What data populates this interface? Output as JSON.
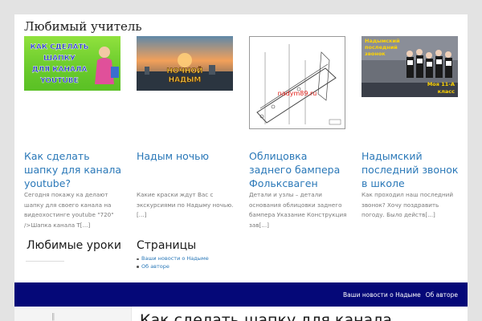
{
  "site": {
    "title": "Любимый учитель"
  },
  "posts": [
    {
      "title": "Как сделать шапку для канала youtube?",
      "excerpt": "Сегодня покажу ка делают шапку для своего канала на видеохостинге youtube \"720\" />Шапка канала Т[...]",
      "thumb_text": [
        "КАК СДЕЛАТЬ",
        "ШАПКУ",
        "ДЛЯ КАНАЛА",
        "YOUTUBE"
      ]
    },
    {
      "title": "Надым ночью",
      "excerpt": "Какие краски ждут Вас с экскурсиями по Надыму ночью. [...]",
      "thumb_text": [
        "НОЧНОЙ",
        "НАДЫМ"
      ]
    },
    {
      "title": "Облицовка заднего бампера Фольксваген",
      "excerpt": "Детали и узлы – детали основания облицовки заднего бампера   Указание Конструкция зав[...]",
      "thumb_text": [
        "nadym89.ru"
      ]
    },
    {
      "title": "Надымский последний звонок в школе",
      "excerpt": "Как проходил наш последний звонок? Хочу поздравить погоду. Было действ[...]",
      "thumb_text": [
        "Надымский",
        "последний",
        "звонок",
        "Моя 11-А",
        "класс"
      ]
    }
  ],
  "widgets": {
    "lessons_title": "Любимые уроки",
    "pages_title": "Страницы",
    "pages": [
      "Ваши новости о Надыме",
      "Об авторе"
    ]
  },
  "nav": {
    "items": [
      "Ваши новости о Надыме",
      "Об авторе"
    ]
  },
  "bottom_post": {
    "title": "Как сделать шапку для канала"
  },
  "colors": {
    "link": "#2a78b8",
    "navbar": "#050878",
    "background": "#e3e3e3"
  }
}
